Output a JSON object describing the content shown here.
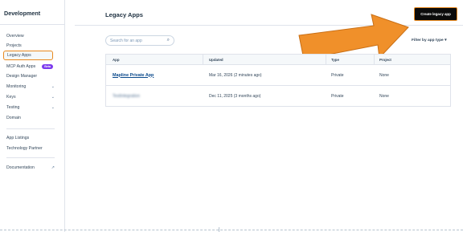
{
  "sidebar": {
    "title": "Development",
    "items": [
      {
        "label": "Overview"
      },
      {
        "label": "Projects"
      },
      {
        "label": "Legacy Apps"
      },
      {
        "label": "MCP Auth Apps",
        "badge": "Beta"
      },
      {
        "label": "Design Manager"
      },
      {
        "label": "Monitoring"
      },
      {
        "label": "Keys"
      },
      {
        "label": "Testing"
      },
      {
        "label": "Domain"
      },
      {
        "label": "App Listings"
      },
      {
        "label": "Technology Partner"
      },
      {
        "label": "Documentation"
      }
    ]
  },
  "main": {
    "title": "Legacy Apps",
    "create_button": "Create legacy app",
    "search_placeholder": "Search for an app",
    "filter_label": "Filter by app type",
    "table": {
      "headers": [
        "App",
        "Updated",
        "Type",
        "Project"
      ],
      "rows": [
        {
          "app": "Mapline Private App",
          "updated": "Mar 16, 2026 (2 minutes ago)",
          "type": "Private",
          "project": "None"
        },
        {
          "app": "TestIntegration",
          "updated": "Dec 11, 2025 (3 months ago)",
          "type": "Private",
          "project": "None"
        }
      ]
    }
  },
  "colors": {
    "arrow": "#f0902a",
    "highlight_border": "#e8891f",
    "beta_badge": "#7c3aed",
    "link": "#0b4a8c"
  }
}
